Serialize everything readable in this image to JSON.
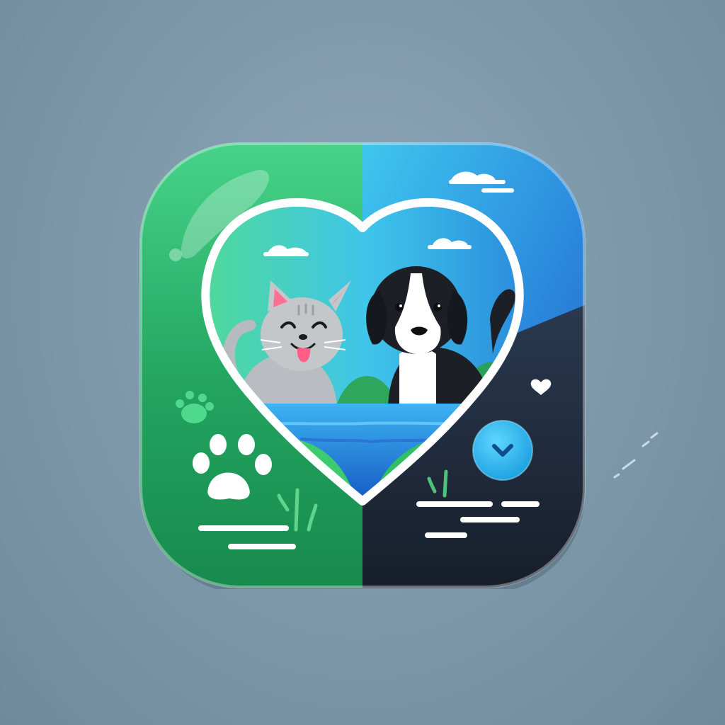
{
  "app_icon": {
    "icons": [
      "heart-frame-icon",
      "cat-icon",
      "dog-icon",
      "paw-print-icon",
      "small-paw-print-icon",
      "small-heart-icon",
      "chevron-down-icon",
      "cloud-icon"
    ],
    "colors": {
      "background": "#7f9aab",
      "tile_green": "#2fb06a",
      "tile_blue": "#2b8fe0",
      "tile_navy": "#1f2a3a",
      "heart_outline": "#ffffff",
      "cat_fur": "#bfc3c6",
      "cat_ear_inner": "#ff6f93",
      "dog_fur": "#1c1f26",
      "water": "#1f7fe0",
      "accent_button": "#2ab4f0"
    }
  }
}
